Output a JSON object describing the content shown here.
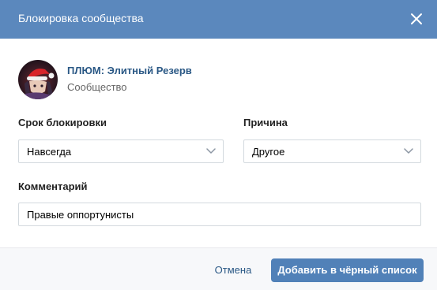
{
  "dialog": {
    "title": "Блокировка сообщества",
    "icons": {
      "close": "close-icon"
    }
  },
  "community": {
    "name": "ПЛЮМ: Элитный Резерв",
    "type": "Сообщество"
  },
  "form": {
    "block_period": {
      "label": "Срок блокировки",
      "value": "Навсегда"
    },
    "reason": {
      "label": "Причина",
      "value": "Другое"
    },
    "comment": {
      "label": "Комментарий",
      "value": "Правые оппортунисты"
    }
  },
  "actions": {
    "cancel_label": "Отмена",
    "submit_label": "Добавить в чёрный список"
  },
  "colors": {
    "header_bg": "#5b88bd",
    "primary_button": "#5181b8",
    "link": "#2a5885",
    "border": "#d3d9de",
    "footer_bg": "#f7f8fa"
  }
}
